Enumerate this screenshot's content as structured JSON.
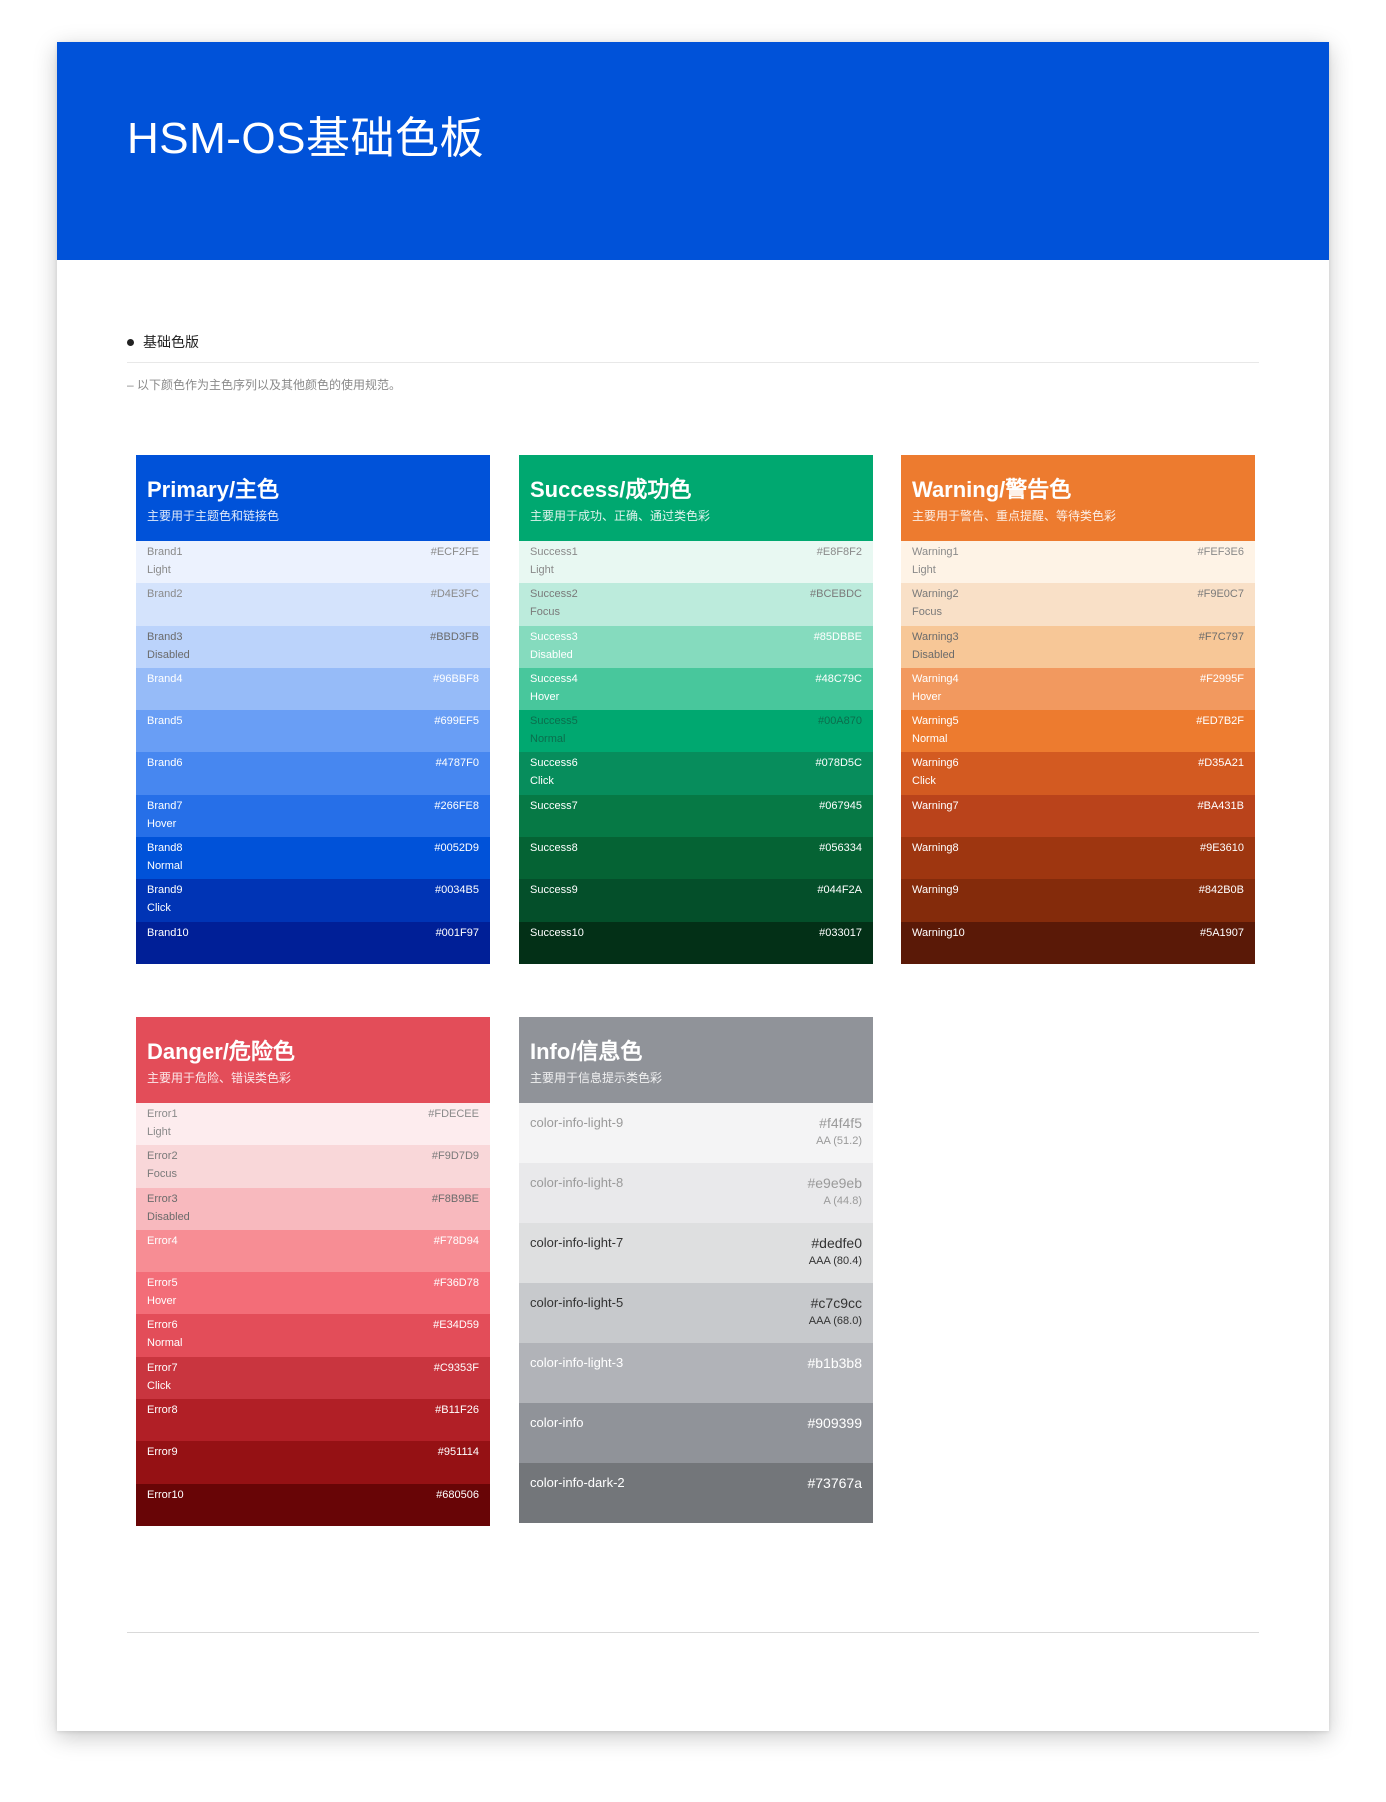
{
  "header": {
    "title": "HSM-OS基础色板",
    "bg": "#0052d9"
  },
  "section": {
    "title": "基础色版",
    "desc": "– 以下颜色作为主色序列以及其他颜色的使用规范。"
  },
  "palettes": [
    {
      "key": "primary",
      "title": "Primary/主色",
      "subtitle": "主要用于主题色和链接色",
      "head_color": "#0052D9",
      "rows": [
        {
          "name": "Brand1",
          "state": "Light",
          "hex": "#ECF2FE",
          "text": "#8a8a8a"
        },
        {
          "name": "Brand2",
          "state": "",
          "hex": "#D4E3FC",
          "text": "#8a8a8a"
        },
        {
          "name": "Brand3",
          "state": "Disabled",
          "hex": "#BBD3FB",
          "text": "#6b6b6b"
        },
        {
          "name": "Brand4",
          "state": "",
          "hex": "#96BBF8",
          "text": "#ffffff"
        },
        {
          "name": "Brand5",
          "state": "",
          "hex": "#699EF5",
          "text": "#ffffff"
        },
        {
          "name": "Brand6",
          "state": "",
          "hex": "#4787F0",
          "text": "#ffffff"
        },
        {
          "name": "Brand7",
          "state": "Hover",
          "hex": "#266FE8",
          "text": "#ffffff"
        },
        {
          "name": "Brand8",
          "state": "Normal",
          "hex": "#0052D9",
          "text": "#ffffff"
        },
        {
          "name": "Brand9",
          "state": "Click",
          "hex": "#0034B5",
          "text": "#ffffff"
        },
        {
          "name": "Brand10",
          "state": "",
          "hex": "#001F97",
          "text": "#ffffff"
        }
      ]
    },
    {
      "key": "success",
      "title": "Success/成功色",
      "subtitle": "主要用于成功、正确、通过类色彩",
      "head_color": "#00A870",
      "rows": [
        {
          "name": "Success1",
          "state": "Light",
          "hex": "#E8F8F2",
          "text": "#8a8a8a"
        },
        {
          "name": "Success2",
          "state": "Focus",
          "hex": "#BCEBDC",
          "text": "#7a7a7a"
        },
        {
          "name": "Success3",
          "state": "Disabled",
          "hex": "#85DBBE",
          "text": "#ffffff"
        },
        {
          "name": "Success4",
          "state": "Hover",
          "hex": "#48C79C",
          "text": "#ffffff"
        },
        {
          "name": "Success5",
          "state": "Normal",
          "hex": "#00A870",
          "text": "#0b6e4d"
        },
        {
          "name": "Success6",
          "state": "Click",
          "hex": "#078D5C",
          "text": "#ffffff"
        },
        {
          "name": "Success7",
          "state": "",
          "hex": "#067945",
          "text": "#ffffff"
        },
        {
          "name": "Success8",
          "state": "",
          "hex": "#056334",
          "text": "#ffffff"
        },
        {
          "name": "Success9",
          "state": "",
          "hex": "#044F2A",
          "text": "#ffffff"
        },
        {
          "name": "Success10",
          "state": "",
          "hex": "#033017",
          "text": "#ffffff"
        }
      ]
    },
    {
      "key": "warning",
      "title": "Warning/警告色",
      "subtitle": "主要用于警告、重点提醒、等待类色彩",
      "head_color": "#ED7B2F",
      "rows": [
        {
          "name": "Warning1",
          "state": "Light",
          "hex": "#FEF3E6",
          "text": "#8a8a8a"
        },
        {
          "name": "Warning2",
          "state": "Focus",
          "hex": "#F9E0C7",
          "text": "#7a7a7a"
        },
        {
          "name": "Warning3",
          "state": "Disabled",
          "hex": "#F7C797",
          "text": "#6b6b6b"
        },
        {
          "name": "Warning4",
          "state": "Hover",
          "hex": "#F2995F",
          "text": "#ffffff"
        },
        {
          "name": "Warning5",
          "state": "Normal",
          "hex": "#ED7B2F",
          "text": "#ffffff"
        },
        {
          "name": "Warning6",
          "state": "Click",
          "hex": "#D35A21",
          "text": "#ffffff"
        },
        {
          "name": "Warning7",
          "state": "",
          "hex": "#BA431B",
          "text": "#ffffff"
        },
        {
          "name": "Warning8",
          "state": "",
          "hex": "#9E3610",
          "text": "#ffffff"
        },
        {
          "name": "Warning9",
          "state": "",
          "hex": "#842B0B",
          "text": "#ffffff"
        },
        {
          "name": "Warning10",
          "state": "",
          "hex": "#5A1907",
          "text": "#ffffff"
        }
      ]
    },
    {
      "key": "danger",
      "title": "Danger/危险色",
      "subtitle": "主要用于危险、错误类色彩",
      "head_color": "#E34D59",
      "rows": [
        {
          "name": "Error1",
          "state": "Light",
          "hex": "#FDECEE",
          "text": "#8a8a8a"
        },
        {
          "name": "Error2",
          "state": "Focus",
          "hex": "#F9D7D9",
          "text": "#7a7a7a"
        },
        {
          "name": "Error3",
          "state": "Disabled",
          "hex": "#F8B9BE",
          "text": "#6b6b6b"
        },
        {
          "name": "Error4",
          "state": "",
          "hex": "#F78D94",
          "text": "#ffffff"
        },
        {
          "name": "Error5",
          "state": "Hover",
          "hex": "#F36D78",
          "text": "#ffffff"
        },
        {
          "name": "Error6",
          "state": "Normal",
          "hex": "#E34D59",
          "text": "#ffffff"
        },
        {
          "name": "Error7",
          "state": "Click",
          "hex": "#C9353F",
          "text": "#ffffff"
        },
        {
          "name": "Error8",
          "state": "",
          "hex": "#B11F26",
          "text": "#ffffff"
        },
        {
          "name": "Error9",
          "state": "",
          "hex": "#951114",
          "text": "#ffffff"
        },
        {
          "name": "Error10",
          "state": "",
          "hex": "#680506",
          "text": "#ffffff"
        }
      ]
    }
  ],
  "info": {
    "title": "Info/信息色",
    "subtitle": "主要用于信息提示类色彩",
    "head_color": "#909399",
    "rows": [
      {
        "name": "color-info-light-9",
        "hex": "#f4f4f5",
        "score": "AA (51.2)",
        "text": "#9a9a9a"
      },
      {
        "name": "color-info-light-8",
        "hex": "#e9e9eb",
        "score": "A (44.8)",
        "text": "#9a9a9a"
      },
      {
        "name": "color-info-light-7",
        "hex": "#dedfe0",
        "score": "AAA (80.4)",
        "text": "#333333"
      },
      {
        "name": "color-info-light-5",
        "hex": "#c7c9cc",
        "score": "AAA (68.0)",
        "text": "#333333"
      },
      {
        "name": "color-info-light-3",
        "hex": "#b1b3b8",
        "score": "",
        "text": "#ffffff"
      },
      {
        "name": "color-info",
        "hex": "#909399",
        "score": "",
        "text": "#ffffff"
      },
      {
        "name": "color-info-dark-2",
        "hex": "#73767a",
        "score": "",
        "text": "#ffffff"
      }
    ]
  }
}
